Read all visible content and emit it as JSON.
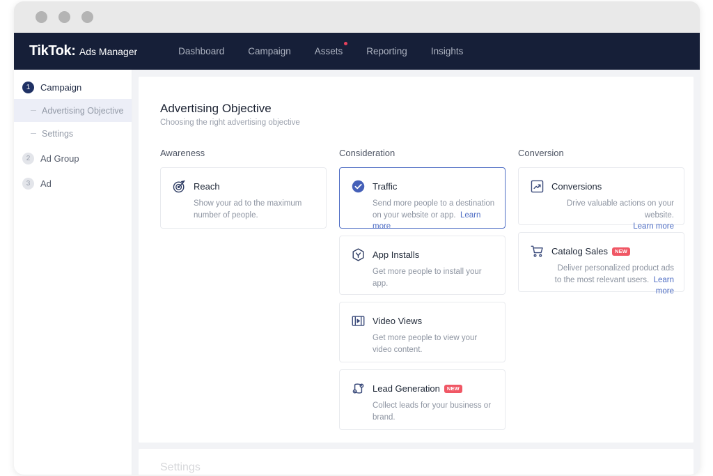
{
  "window": {
    "dots": [
      "close-dot",
      "minimize-dot",
      "maximize-dot"
    ]
  },
  "navbar": {
    "brand_name": "TikTok",
    "brand_colon": ":",
    "brand_product": "Ads Manager",
    "links": [
      {
        "label": "Dashboard",
        "has_dot": false
      },
      {
        "label": "Campaign",
        "has_dot": false
      },
      {
        "label": "Assets",
        "has_dot": true
      },
      {
        "label": "Reporting",
        "has_dot": false
      },
      {
        "label": "Insights",
        "has_dot": false
      }
    ],
    "background": "#161f38",
    "link_color": "#aeb4c2",
    "dot_color": "#e8415c"
  },
  "sidebar": {
    "steps": [
      {
        "num": "1",
        "label": "Campaign",
        "active": true
      },
      {
        "num": "2",
        "label": "Ad Group",
        "active": false
      },
      {
        "num": "3",
        "label": "Ad",
        "active": false
      }
    ],
    "campaign_subitems": [
      {
        "label": "Advertising Objective",
        "selected": true
      },
      {
        "label": "Settings",
        "selected": false
      }
    ],
    "active_bg": "#eceef7"
  },
  "main": {
    "title": "Advertising Objective",
    "subtitle": "Choosing the right advertising objective",
    "selected_border_color": "#4e6dc4",
    "link_color": "#4e6dc4",
    "badge_color": "#f05765",
    "badge_text": "NEW",
    "learn_more_label": "Learn more",
    "columns": [
      {
        "heading": "Awareness",
        "cards": [
          {
            "id": "reach",
            "icon": "target-icon",
            "title": "Reach",
            "description": "Show your ad to the maximum number of people.",
            "selected": false,
            "badge": null,
            "learn_more": false,
            "align": "left"
          }
        ]
      },
      {
        "heading": "Consideration",
        "cards": [
          {
            "id": "traffic",
            "icon": "check-circle-icon",
            "title": "Traffic",
            "description": "Send more people to a destination on your website or app.",
            "selected": true,
            "badge": null,
            "learn_more": true,
            "align": "left"
          },
          {
            "id": "app-installs",
            "icon": "hexagon-download-icon",
            "title": "App Installs",
            "description": "Get more people to install your app.",
            "selected": false,
            "badge": null,
            "learn_more": false,
            "align": "left"
          },
          {
            "id": "video-views",
            "icon": "film-play-icon",
            "title": "Video Views",
            "description": "Get more people to view your video content.",
            "selected": false,
            "badge": null,
            "learn_more": false,
            "align": "left"
          },
          {
            "id": "lead-generation",
            "icon": "funnel-leads-icon",
            "title": "Lead Generation",
            "description": "Collect leads for your business or brand.",
            "selected": false,
            "badge": "NEW",
            "learn_more": false,
            "align": "left"
          }
        ]
      },
      {
        "heading": "Conversion",
        "cards": [
          {
            "id": "conversions",
            "icon": "trending-up-box-icon",
            "title": "Conversions",
            "description": "Drive valuable actions on your website.",
            "selected": false,
            "badge": null,
            "learn_more": true,
            "align": "right"
          },
          {
            "id": "catalog-sales",
            "icon": "shopping-cart-icon",
            "title": "Catalog Sales",
            "description": "Deliver personalized product ads to the most relevant users.",
            "selected": false,
            "badge": "NEW",
            "learn_more": true,
            "align": "right"
          }
        ]
      }
    ]
  },
  "bottom_panel": {
    "clipped_title": "Settings"
  }
}
